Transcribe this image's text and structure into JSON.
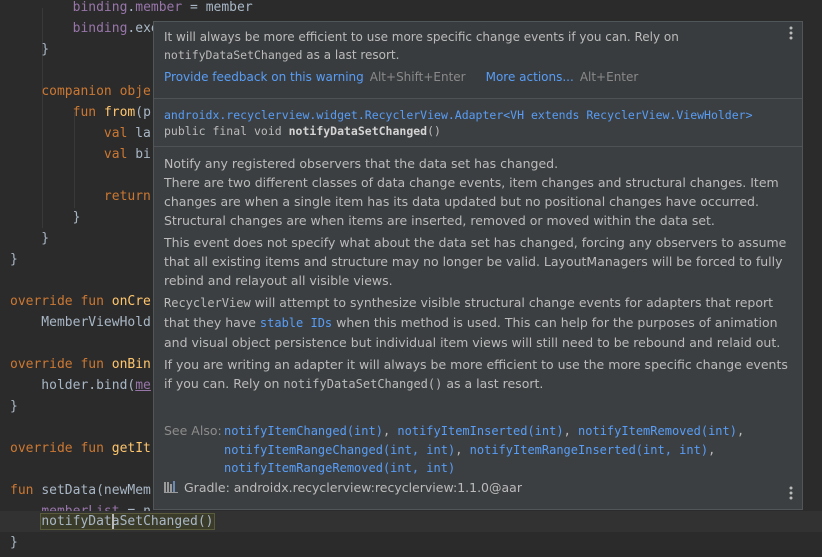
{
  "editor": {
    "lines": [
      {
        "id": "l1",
        "parts": [
          [
            "",
            "        "
          ],
          [
            "prop",
            "binding"
          ],
          [
            "",
            "."
          ],
          [
            "prop",
            "member"
          ],
          [
            "",
            " = member"
          ]
        ]
      },
      {
        "id": "l2",
        "parts": [
          [
            "",
            "        "
          ],
          [
            "prop",
            "binding"
          ],
          [
            "",
            ".executePendingBindings()"
          ]
        ]
      },
      {
        "id": "l3",
        "parts": [
          [
            "",
            "    }"
          ]
        ]
      },
      {
        "id": "l4",
        "parts": [
          [
            "",
            ""
          ]
        ]
      },
      {
        "id": "l5",
        "parts": [
          [
            "",
            "    "
          ],
          [
            "kw",
            "companion obje"
          ]
        ]
      },
      {
        "id": "l6",
        "parts": [
          [
            "",
            "        "
          ],
          [
            "kw",
            "fun "
          ],
          [
            "fn",
            "from"
          ],
          [
            "",
            "(p"
          ]
        ]
      },
      {
        "id": "l7",
        "parts": [
          [
            "",
            "            "
          ],
          [
            "kw",
            "val "
          ],
          [
            "",
            "la"
          ]
        ]
      },
      {
        "id": "l8",
        "parts": [
          [
            "",
            "            "
          ],
          [
            "kw",
            "val "
          ],
          [
            "",
            "bi"
          ]
        ]
      },
      {
        "id": "l9",
        "parts": [
          [
            "",
            ""
          ]
        ]
      },
      {
        "id": "l10",
        "parts": [
          [
            "",
            "            "
          ],
          [
            "kw",
            "return"
          ]
        ]
      },
      {
        "id": "l11",
        "parts": [
          [
            "",
            "        }"
          ]
        ]
      },
      {
        "id": "l12",
        "parts": [
          [
            "",
            "    }"
          ]
        ]
      },
      {
        "id": "l13",
        "parts": [
          [
            "",
            "}"
          ]
        ]
      },
      {
        "id": "l14",
        "parts": [
          [
            "",
            ""
          ]
        ]
      },
      {
        "id": "l15",
        "parts": [
          [
            "kw",
            "override fun "
          ],
          [
            "fn",
            "onCre"
          ]
        ]
      },
      {
        "id": "l16",
        "parts": [
          [
            "",
            "    MemberViewHold"
          ]
        ]
      },
      {
        "id": "l17",
        "parts": [
          [
            "",
            ""
          ]
        ]
      },
      {
        "id": "l18",
        "parts": [
          [
            "kw",
            "override fun "
          ],
          [
            "fn",
            "onBin"
          ]
        ]
      },
      {
        "id": "l19",
        "parts": [
          [
            "",
            "    holder.bind("
          ],
          [
            "propul",
            "me"
          ]
        ]
      },
      {
        "id": "l20",
        "parts": [
          [
            "",
            "}"
          ]
        ]
      },
      {
        "id": "l21",
        "parts": [
          [
            "",
            ""
          ]
        ]
      },
      {
        "id": "l22",
        "parts": [
          [
            "kw",
            "override fun "
          ],
          [
            "fn",
            "getIt"
          ]
        ]
      },
      {
        "id": "l23",
        "parts": [
          [
            "",
            ""
          ]
        ]
      },
      {
        "id": "l24",
        "parts": [
          [
            "kw",
            "fun "
          ],
          [
            "",
            "setData(newMem"
          ]
        ]
      },
      {
        "id": "l25",
        "parts": [
          [
            "",
            "    "
          ],
          [
            "propul",
            "memberList"
          ],
          [
            "",
            " = n"
          ]
        ]
      }
    ],
    "current_line": {
      "before": "notifyDat",
      "after": "aSetChanged()"
    },
    "closing_brace": "}"
  },
  "popup": {
    "warning_text_1": "It will always be more efficient to use more specific change events if you can. Rely on",
    "warning_code": "notifyDataSetChanged",
    "warning_text_2": " as a last resort.",
    "feedback_link": "Provide feedback on this warning",
    "feedback_shortcut": "Alt+Shift+Enter",
    "more_actions_link": "More actions...",
    "more_actions_shortcut": "Alt+Enter",
    "signature_class": "androidx.recyclerview.widget.RecyclerView.Adapter<VH extends RecyclerView.ViewHolder>",
    "signature_prefix": "public final void ",
    "signature_method": "notifyDataSetChanged",
    "signature_suffix": "()",
    "desc_1a": "Notify any registered observers that the data set has changed.",
    "desc_1b": "There are two different classes of data change events, item changes and structural changes. Item changes are when a single item has its data updated but no positional changes have occurred. Structural changes are when items are inserted, removed or moved within the data set.",
    "desc_2": "This event does not specify what about the data set has changed, forcing any observers to assume that all existing items and structure may no longer be valid. LayoutManagers will be forced to fully rebind and relayout all visible views.",
    "desc_3_code": "RecyclerView",
    "desc_3_a": " will attempt to synthesize visible structural change events for adapters that report that they have ",
    "desc_3_link": "stable IDs",
    "desc_3_b": " when this method is used. This can help for the purposes of animation and visual object persistence but individual item views will still need to be rebound and relaid out.",
    "desc_4_a": "If you are writing an adapter it will always be more efficient to use the more specific change events if you can. Rely on ",
    "desc_4_code": "notifyDataSetChanged()",
    "desc_4_b": " as a last resort.",
    "see_also_label": "See Also:",
    "see_also": [
      "notifyItemChanged(int)",
      "notifyItemInserted(int)",
      "notifyItemRemoved(int)",
      "notifyItemRangeChanged(int, int)",
      "notifyItemRangeInserted(int, int)",
      "notifyItemRangeRemoved(int, int)"
    ],
    "gradle_text": "Gradle: androidx.recyclerview:recyclerview:1.1.0@aar",
    "menu_icon": "kebab-vertical-icon",
    "library_icon": "library-icon"
  }
}
